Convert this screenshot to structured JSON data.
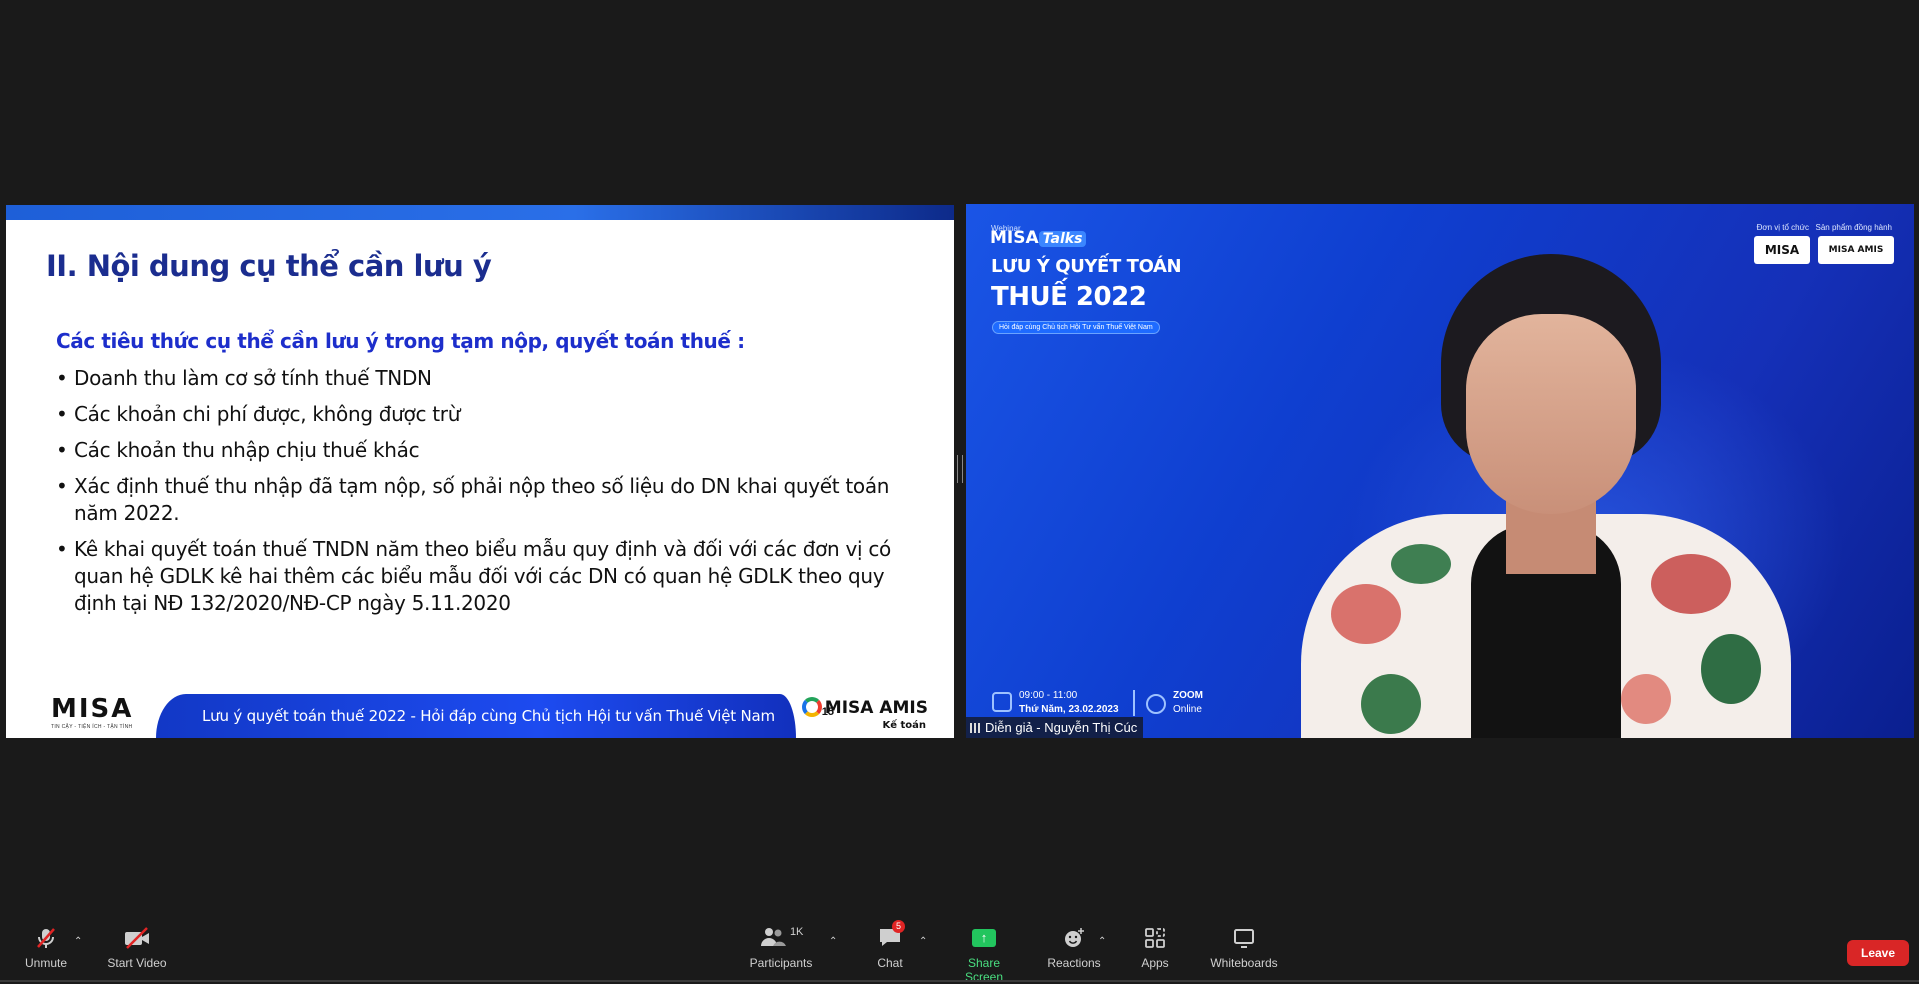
{
  "slide": {
    "title": "II. Nội dung cụ thể cần lưu ý",
    "subtitle": "Các tiêu thức cụ thể cần lưu ý trong  tạm nộp, quyết toán thuế :",
    "bullets": [
      "Doanh thu làm cơ sở tính thuế TNDN",
      "Các khoản chi phí được, không được trừ",
      "Các khoản thu nhập chịu thuế khác",
      "Xác định thuế thu nhập đã tạm nộp, số phải nộp theo số liệu do DN khai quyết toán năm 2022.",
      "Kê khai  quyết toán thuế TNDN  năm theo biểu mẫu quy định và đối với các đơn vị có quan hệ GDLK kê hai thêm các biểu mẫu đối với các DN có quan hệ GDLK theo quy định tại NĐ 132/2020/NĐ-CP ngày 5.11.2020"
    ],
    "footer_text": "Lưu ý quyết toán thuế 2022 - Hỏi đáp cùng Chủ tịch Hội tư vấn Thuế Việt Nam",
    "logo_left": "MISA",
    "logo_left_tag": "TIN CẬY - TIỆN ÍCH - TẬN TÌNH",
    "logo_right": "MISA AMIS",
    "logo_right_sub": "Kế toán",
    "logo_right_num": "15"
  },
  "video": {
    "webinar": "Webinar",
    "brand": "MISA",
    "brand_talks": "Talks",
    "title_line1": "LƯU Ý QUYẾT TOÁN",
    "title_line2": "THUẾ 2022",
    "pill": "Hỏi đáp cùng Chủ tịch Hội Tư vấn Thuế Việt Nam",
    "org_label": "Đơn vị tổ chức",
    "product_label": "Sản phẩm đồng hành",
    "org_logo": "MISA",
    "product_logo": "MISA AMIS",
    "time": "09:00 - 11:00",
    "date": "Thứ Năm, 23.02.2023",
    "platform": "ZOOM",
    "platform_sub": "Online",
    "speaker_name": "Diễn giả - Nguyễn Thị Cúc"
  },
  "toolbar": {
    "unmute": "Unmute",
    "start_video": "Start Video",
    "participants": "Participants",
    "participants_count": "1K",
    "chat": "Chat",
    "chat_badge": "5",
    "share_screen": "Share Screen",
    "reactions": "Reactions",
    "apps": "Apps",
    "whiteboards": "Whiteboards",
    "leave": "Leave"
  },
  "colors": {
    "title_blue": "#1b2d8f",
    "subtitle_blue": "#1d2ecb",
    "share_green": "#22c55e",
    "leave_red": "#d92626",
    "badge_red": "#e02424"
  }
}
